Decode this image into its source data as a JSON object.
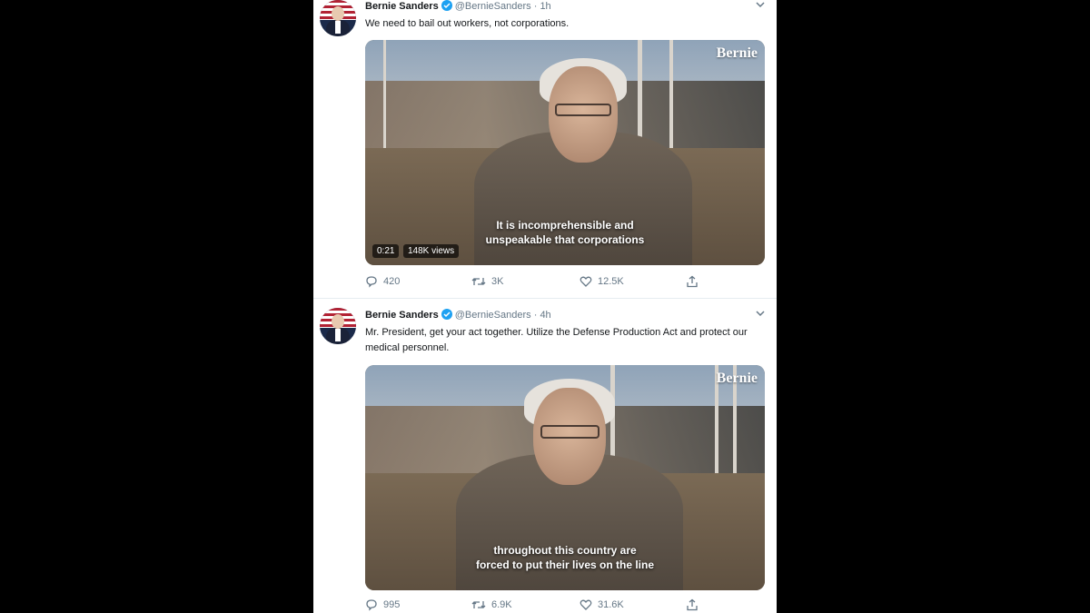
{
  "tweets": [
    {
      "name": "Bernie Sanders",
      "handle": "@BernieSanders",
      "separator": "·",
      "time": "1h",
      "text": "We need to bail out workers, not corporations.",
      "video": {
        "watermark": "Bernie",
        "caption_line1": "It is incomprehensible and",
        "caption_line2": "unspeakable that corporations",
        "duration": "0:21",
        "views": "148K views"
      },
      "actions": {
        "replies": "420",
        "retweets": "3K",
        "likes": "12.5K"
      }
    },
    {
      "name": "Bernie Sanders",
      "handle": "@BernieSanders",
      "separator": "·",
      "time": "4h",
      "text": "Mr. President, get your act together. Utilize the Defense Production Act and protect our medical personnel.",
      "video": {
        "watermark": "Bernie",
        "caption_line1": "throughout this country are",
        "caption_line2": "forced to put their lives on the line"
      },
      "actions": {
        "replies": "995",
        "retweets": "6.9K",
        "likes": "31.6K"
      }
    }
  ],
  "icons": {
    "verified": "verified-badge-icon",
    "chevron": "chevron-down-icon",
    "reply": "reply-icon",
    "retweet": "retweet-icon",
    "like": "heart-icon",
    "share": "share-icon"
  },
  "colors": {
    "verified": "#1da1f2",
    "action": "#657786",
    "background": "#000000"
  }
}
